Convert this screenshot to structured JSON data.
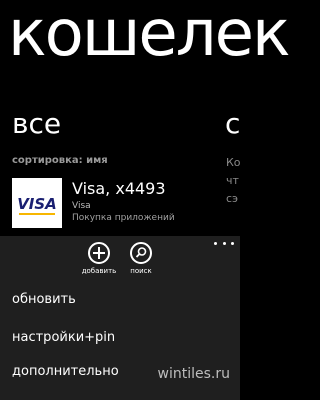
{
  "app": {
    "title": "кошелек"
  },
  "pivot": {
    "active": "все",
    "next": "с"
  },
  "list": {
    "sort_label": "сортировка: имя",
    "side_peek": "Ко\nчт\nсэ",
    "items": [
      {
        "name": "Visa, x4493",
        "brand": "Visa",
        "purpose": "Покупка приложений",
        "logo_text": "VISA",
        "logo_color": "#1a1f71",
        "logo_accent": "#f7b600"
      }
    ]
  },
  "app_bar": {
    "background": "#1f1f1f",
    "buttons": [
      {
        "label": "добавить",
        "icon": "add-icon"
      },
      {
        "label": "поиск",
        "icon": "search-icon"
      }
    ],
    "menu": [
      {
        "label": "обновить"
      },
      {
        "label": "настройки+pin"
      },
      {
        "label": "дополнительно"
      }
    ]
  },
  "watermark": "wintiles.ru"
}
